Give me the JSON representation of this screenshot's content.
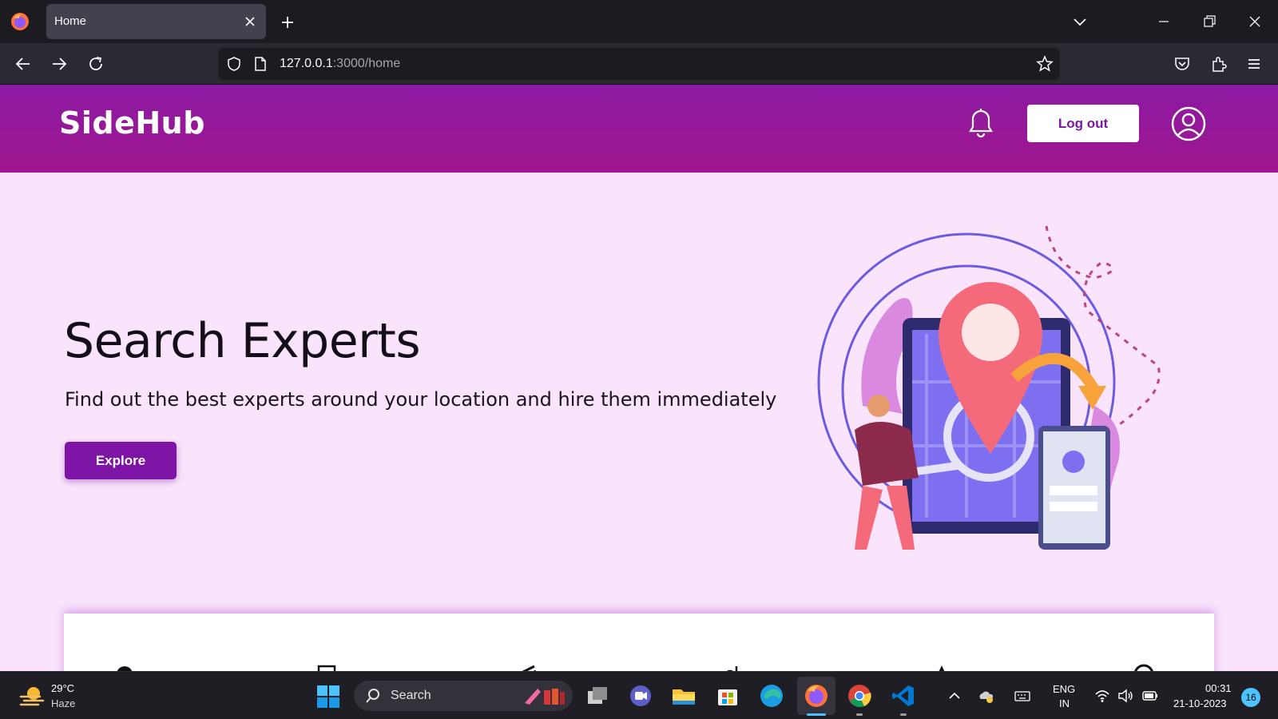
{
  "browser": {
    "tab_title": "Home",
    "url_host": "127.0.0.1",
    "url_path": ":3000/home"
  },
  "site": {
    "brand": "SideHub",
    "logout_label": "Log out",
    "hero_title": "Search Experts",
    "hero_subtitle": "Find out the best experts around your location and hire them immediately",
    "explore_label": "Explore"
  },
  "taskbar": {
    "temperature": "29°C",
    "weather": "Haze",
    "search_label": "Search",
    "lang_line1": "ENG",
    "lang_line2": "IN",
    "time": "00:31",
    "date": "21-10-2023",
    "notification_count": "16"
  },
  "colors": {
    "header_gradient_start": "#8c1aa3",
    "header_gradient_end": "#a0178f",
    "page_background": "#f9e4fb",
    "primary_button": "#7e14a6"
  }
}
